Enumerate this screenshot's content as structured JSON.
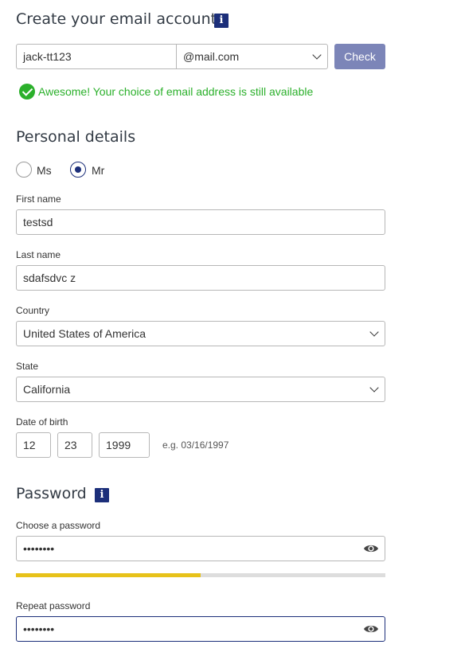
{
  "account": {
    "title": "Create your email account",
    "info_icon": "info-icon",
    "email_local": "jack-tt123",
    "email_domain": "@mail.com",
    "check_label": "Check",
    "availability_message": "Awesome! Your choice of email address is still available",
    "availability_color": "#2bb02b"
  },
  "personal": {
    "title": "Personal details",
    "salutation_options": [
      {
        "label": "Ms",
        "selected": false
      },
      {
        "label": "Mr",
        "selected": true
      }
    ],
    "first_name_label": "First name",
    "first_name_value": "testsd",
    "last_name_label": "Last name",
    "last_name_value": "sdafsdvc z",
    "country_label": "Country",
    "country_value": "United States of America",
    "state_label": "State",
    "state_value": "California",
    "dob_label": "Date of birth",
    "dob_month": "12",
    "dob_day": "23",
    "dob_year": "1999",
    "dob_hint": "e.g. 03/16/1997"
  },
  "password": {
    "title": "Password",
    "info_icon": "info-icon",
    "choose_label": "Choose a password",
    "choose_value": "••••••••",
    "strength_fraction": 0.5,
    "strength_color": "#e7c21a",
    "repeat_label": "Repeat password",
    "repeat_value": "••••••••",
    "toggle_icon": "eye-icon"
  },
  "colors": {
    "accent": "#1c2f7a",
    "button": "#7c85b8"
  }
}
